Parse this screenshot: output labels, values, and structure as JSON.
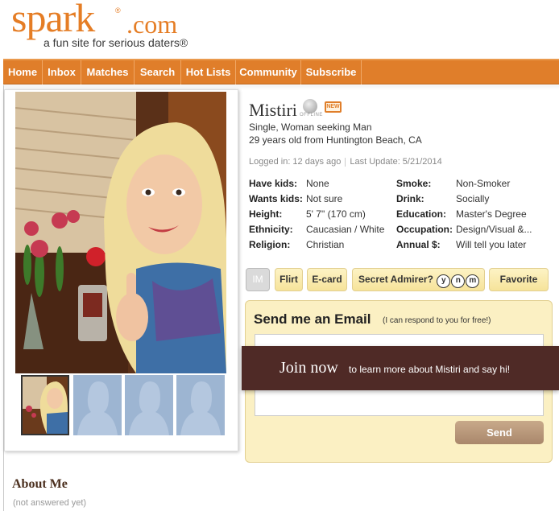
{
  "brand": {
    "logo_text": "spark",
    "logo_suffix": ".com",
    "registered": "®",
    "tagline": "a fun site for serious daters®"
  },
  "nav": [
    "Home",
    "Inbox",
    "Matches",
    "Search",
    "Hot Lists",
    "Community",
    "Subscribe"
  ],
  "profile": {
    "name": "Mistiri",
    "status": "OFFLINE",
    "new_badge": "NEW",
    "seeking": "Single, Woman seeking Man",
    "age_location": "29 years old from Huntington Beach, CA",
    "logged_in": "Logged in: 12 days ago",
    "last_update": "Last Update: 5/21/2014"
  },
  "details_left": [
    {
      "label": "Have kids:",
      "value": "None"
    },
    {
      "label": "Wants kids:",
      "value": "Not sure"
    },
    {
      "label": "Height:",
      "value": "5' 7\" (170 cm)"
    },
    {
      "label": "Ethnicity:",
      "value": "Caucasian / White"
    },
    {
      "label": "Religion:",
      "value": "Christian"
    }
  ],
  "details_right": [
    {
      "label": "Smoke:",
      "value": "Non-Smoker"
    },
    {
      "label": "Drink:",
      "value": "Socially"
    },
    {
      "label": "Education:",
      "value": "Master's Degree"
    },
    {
      "label": "Occupation:",
      "value": "Design/Visual &..."
    },
    {
      "label": "Annual $:",
      "value": "Will tell you later"
    }
  ],
  "actions": {
    "im": "IM",
    "flirt": "Flirt",
    "ecard": "E-card",
    "secret_admirer": "Secret Admirer?",
    "yes": "y",
    "no": "n",
    "maybe": "m",
    "favorite": "Favorite"
  },
  "email": {
    "title": "Send me an Email",
    "subtitle": "(I can respond to you for free!)",
    "send": "Send"
  },
  "join": {
    "title": "Join now",
    "subtitle": "to learn more about Mistiri and say hi!"
  },
  "about": {
    "title": "About Me",
    "body": "(not answered yet)"
  }
}
